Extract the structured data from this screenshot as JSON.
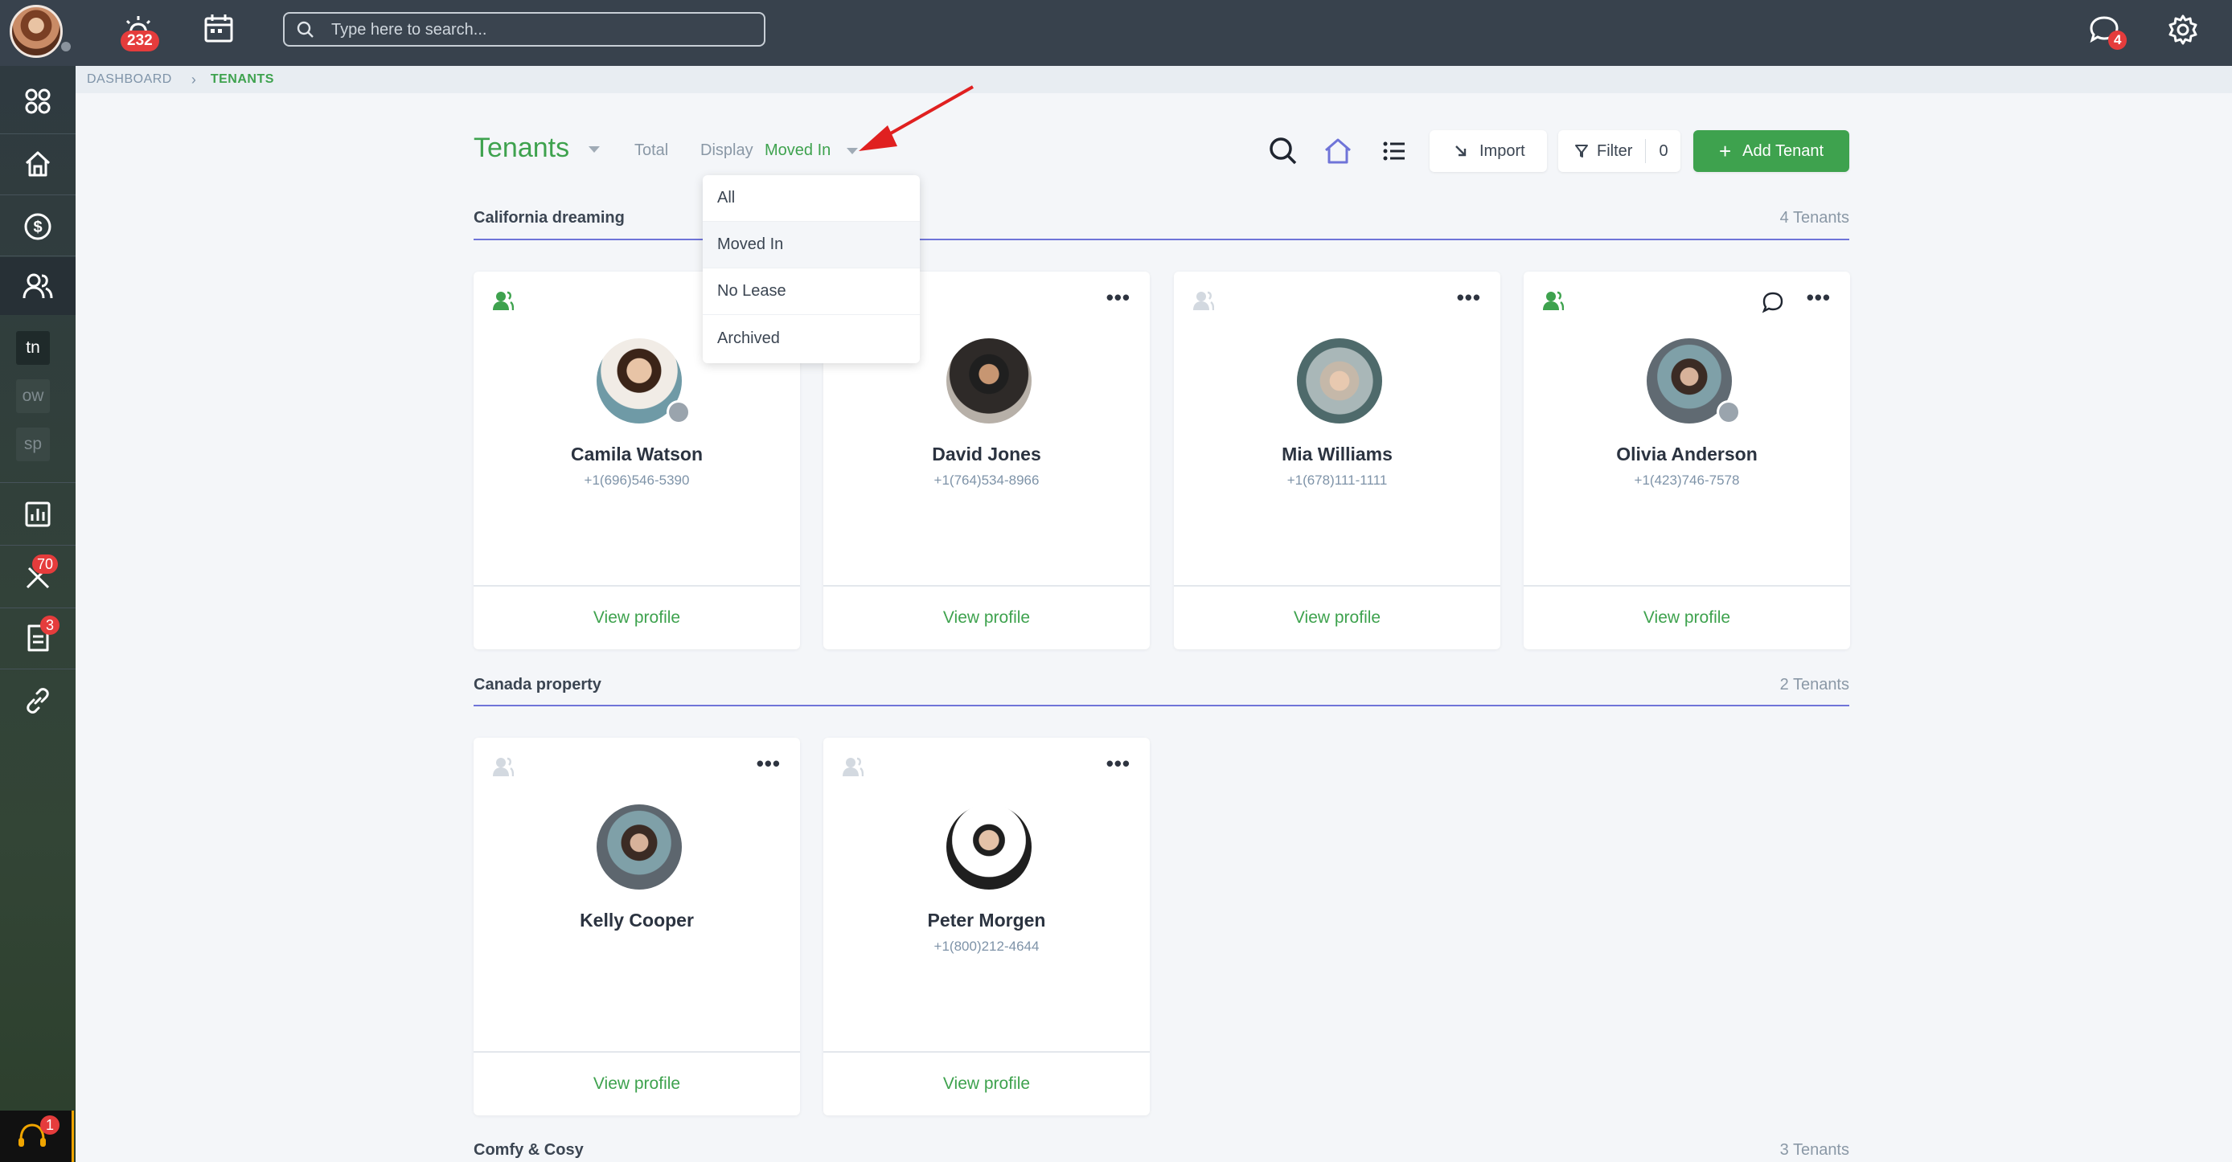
{
  "topbar": {
    "alerts_badge": "232",
    "search_placeholder": "Type here to search...",
    "messages_badge": "4"
  },
  "sidebar": {
    "short_items": [
      "tn",
      "ow",
      "sp"
    ],
    "tools_badge": "70",
    "docs_badge": "3",
    "support_badge": "1"
  },
  "breadcrumb": {
    "root": "DASHBOARD",
    "separator": "›",
    "current": "TENANTS"
  },
  "header": {
    "title": "Tenants",
    "total_label": "Total",
    "display_label": "Display",
    "display_value": "Moved In",
    "import_label": "Import",
    "filter_label": "Filter",
    "filter_count": "0",
    "add_label": "Add Tenant"
  },
  "dropdown": {
    "options": [
      "All",
      "Moved In",
      "No Lease",
      "Archived"
    ],
    "selected": "Moved In"
  },
  "sections": [
    {
      "title": "California dreaming",
      "count": "4 Tenants",
      "tenants": [
        {
          "name": "Camila Watson",
          "phone": "+1(696)546-5390",
          "view": "View profile"
        },
        {
          "name": "David Jones",
          "phone": "+1(764)534-8966",
          "view": "View profile"
        },
        {
          "name": "Mia Williams",
          "phone": "+1(678)111-1111",
          "view": "View profile"
        },
        {
          "name": "Olivia Anderson",
          "phone": "+1(423)746-7578",
          "view": "View profile"
        }
      ]
    },
    {
      "title": "Canada property",
      "count": "2 Tenants",
      "tenants": [
        {
          "name": "Kelly Cooper",
          "phone": "",
          "view": "View profile"
        },
        {
          "name": "Peter Morgen",
          "phone": "+1(800)212-4644",
          "view": "View profile"
        }
      ]
    },
    {
      "title": "Comfy & Cosy",
      "count": "3 Tenants"
    }
  ],
  "colors": {
    "accent_green": "#3ea24e",
    "topbar": "#38424d",
    "section_line": "#6f74d8",
    "badge_red": "#e53c3c"
  }
}
